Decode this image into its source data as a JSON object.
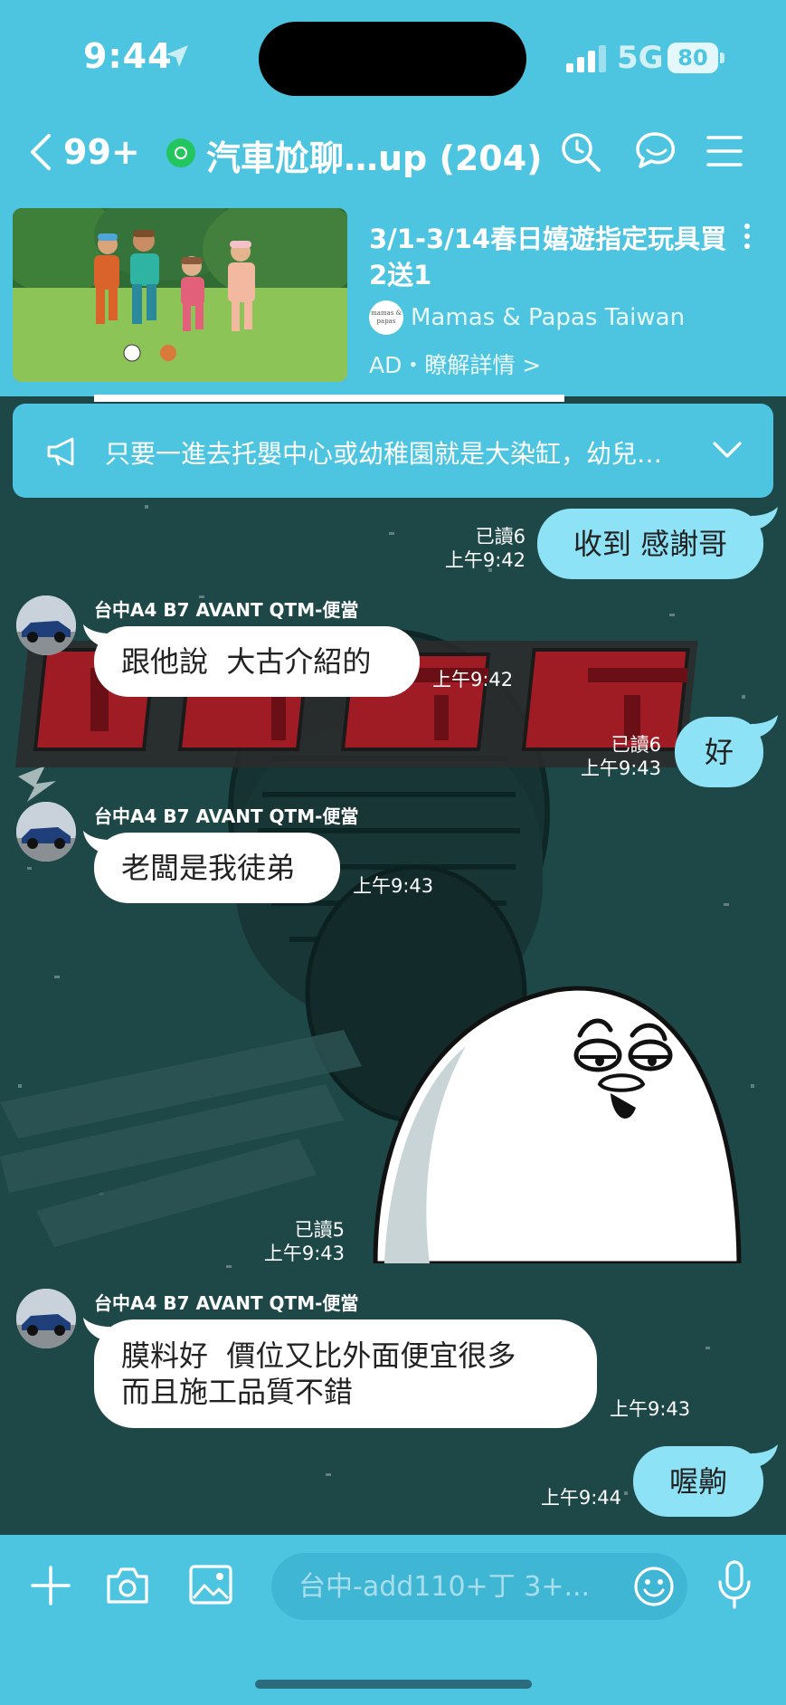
{
  "status_bar": {
    "time": "9:44",
    "network": "5G",
    "battery": "80"
  },
  "header": {
    "back_count": "99+",
    "title": "汽車尬聊…up (204)"
  },
  "ad": {
    "title": "3/1-3/14春日嬉遊指定玩具買2送1",
    "brand_logo_text": "mamas & papas",
    "brand": "Mamas & Papas Taiwan",
    "tag": "AD・瞭解詳情 >"
  },
  "announcement": {
    "text": "只要一進去托嬰中心或幼稚園就是大染缸，幼兒園也會一直生病"
  },
  "messages": [
    {
      "direction": "out",
      "text": "收到 感謝哥",
      "read": "已讀6",
      "time": "上午9:42"
    },
    {
      "direction": "in",
      "sender": "台中A4 B7 AVANT QTM-便當",
      "text": "跟他說  大古介紹的",
      "time": "上午9:42"
    },
    {
      "direction": "out",
      "text": "好",
      "read": "已讀6",
      "time": "上午9:43"
    },
    {
      "direction": "in",
      "sender": "台中A4 B7 AVANT QTM-便當",
      "text": "老闆是我徒弟",
      "time": "上午9:43"
    },
    {
      "direction": "out",
      "type": "sticker",
      "sticker": "smirking-egg-sticker",
      "read": "已讀5",
      "time": "上午9:43"
    },
    {
      "direction": "in",
      "sender": "台中A4 B7 AVANT QTM-便當",
      "text": "膜料好  價位又比外面便宜很多\n而且施工品質不錯",
      "time": "上午9:43"
    },
    {
      "direction": "out",
      "text": "喔齁",
      "time": "上午9:44"
    }
  ],
  "background_art": {
    "title_text": "汽車尬聊",
    "accent": "#a01c25"
  },
  "input": {
    "placeholder": "台中-add110+丁 3+..."
  },
  "colors": {
    "header_bg": "#4ec5e0",
    "chat_bg": "#1e4848",
    "outgoing_bubble": "#8ee2f5",
    "incoming_bubble": "#ffffff"
  }
}
